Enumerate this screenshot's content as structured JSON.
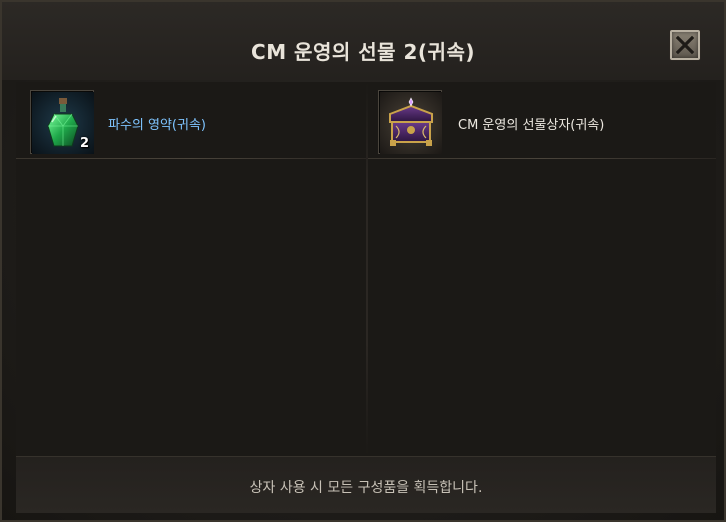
{
  "dialog": {
    "title": "CM 운영의 선물 2(귀속)",
    "close_icon": "close-icon"
  },
  "items": [
    {
      "name": "파수의 영약(귀속)",
      "count": "2",
      "icon": "green-potion-icon",
      "name_color": "#7ec4ff"
    },
    {
      "name": "CM 운영의 선물상자(귀속)",
      "count": "",
      "icon": "gift-chest-icon",
      "name_color": "#ece8e0"
    }
  ],
  "footer": {
    "message": "상자 사용 시 모든 구성품을 획득합니다."
  }
}
